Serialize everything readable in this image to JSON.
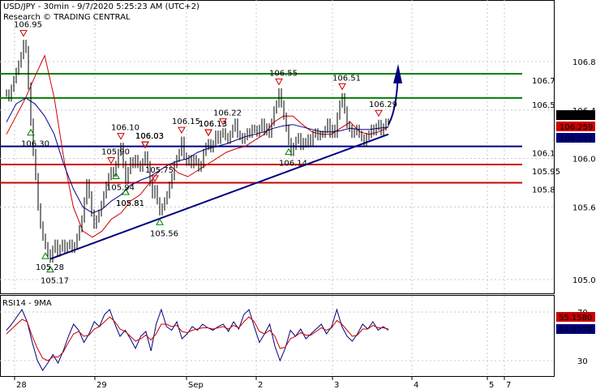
{
  "header": {
    "title": "USD/JPY - 30min - 9/7/2020 5:25:23 AM (UTC+2)",
    "credit": "Research © TRADING CENTRAL"
  },
  "rsi_label": "RSI14 - 9MA",
  "colors": {
    "price": "#000000",
    "ma_red": "#cc0000",
    "ma_blue": "#00008b",
    "support": "#000080",
    "resistance_green": "#008000",
    "level_red": "#cc0000",
    "arrow": "#000080"
  },
  "chart_data": [
    {
      "type": "line",
      "name": "price",
      "ylim": [
        104.85,
        107.05
      ],
      "yticks": [
        "106.8",
        "106.4",
        "106.0",
        "105.6",
        "105.0"
      ],
      "xticks": [
        "28",
        "29",
        "Sep",
        "2",
        "3",
        "4",
        "5",
        "7"
      ],
      "x": [
        0,
        3,
        6,
        9,
        12,
        15,
        18,
        21,
        24,
        27,
        30,
        33,
        36,
        39,
        42,
        45,
        48,
        51,
        54,
        57,
        60,
        63,
        66,
        69,
        72,
        75,
        78,
        81,
        84,
        87,
        90,
        93,
        96,
        99,
        102,
        105,
        108,
        111,
        114,
        117,
        120,
        123,
        126,
        129,
        132,
        135,
        138,
        141,
        144,
        147,
        150,
        153,
        156,
        159,
        162,
        165,
        168,
        171,
        174,
        177,
        180,
        183,
        186,
        189,
        192,
        195,
        198,
        201,
        204,
        207,
        210,
        213,
        216,
        219,
        222,
        225,
        228,
        231,
        234,
        237,
        240,
        243,
        246,
        249,
        252,
        255,
        258,
        261,
        264,
        267,
        270,
        273,
        276,
        279,
        282,
        285,
        288,
        291,
        294,
        297,
        300,
        303,
        306,
        309,
        312,
        315,
        318,
        321,
        324,
        327,
        330,
        333,
        336,
        339,
        342,
        345,
        348,
        351,
        354,
        357,
        360,
        363,
        366,
        369,
        372,
        375,
        378,
        381,
        384,
        387,
        390,
        393,
        396,
        399,
        402,
        405,
        408,
        411,
        414,
        417,
        420,
        423,
        426,
        429,
        432,
        435,
        438,
        441,
        444,
        447,
        450,
        453,
        456,
        459,
        462,
        465,
        468,
        471,
        474,
        477,
        480,
        483,
        486,
        489,
        492,
        495,
        498,
        501,
        504,
        507,
        510,
        513,
        516,
        519,
        522,
        525,
        528,
        531,
        534,
        537,
        540,
        543,
        546,
        549,
        552,
        555,
        558,
        561,
        564,
        567,
        570,
        573,
        576,
        579,
        582,
        585,
        588,
        591,
        594,
        597,
        600,
        603,
        606,
        609,
        612,
        615,
        618,
        621,
        624,
        627,
        630
      ],
      "series": [
        {
          "values": [
            106.54,
            106.5,
            106.58,
            106.65,
            106.72,
            106.78,
            106.85,
            106.95,
            106.9,
            106.6,
            106.3,
            106.05,
            105.85,
            105.6,
            105.45,
            105.35,
            105.28,
            105.22,
            105.17,
            105.25,
            105.3,
            105.22,
            105.26,
            105.3,
            105.25,
            105.28,
            105.3,
            105.25,
            105.28,
            105.35,
            105.42,
            105.5,
            105.65,
            105.8,
            105.7,
            105.55,
            105.45,
            105.5,
            105.55,
            105.62,
            105.7,
            105.78,
            105.85,
            105.9,
            105.88,
            105.95,
            106.05,
            106.1,
            105.95,
            105.82,
            105.9,
            105.98,
            105.95,
            106.0,
            105.95,
            105.92,
            105.97,
            106.03,
            105.95,
            105.8,
            105.7,
            105.75,
            105.65,
            105.56,
            105.6,
            105.65,
            105.7,
            105.78,
            105.85,
            105.95,
            106.0,
            106.05,
            106.15,
            106.02,
            105.97,
            106.0,
            105.95,
            106.0,
            105.97,
            105.92,
            105.95,
            106.05,
            106.1,
            106.13,
            106.08,
            106.12,
            106.2,
            106.15,
            106.2,
            106.22,
            106.18,
            106.15,
            106.2,
            106.25,
            106.3,
            106.2,
            106.18,
            106.15,
            106.18,
            106.22,
            106.2,
            106.25,
            106.24,
            106.21,
            106.25,
            106.3,
            106.22,
            106.26,
            106.2,
            106.3,
            106.4,
            106.45,
            106.55,
            106.45,
            106.35,
            106.25,
            106.14,
            106.05,
            106.1,
            106.15,
            106.18,
            106.1,
            106.14,
            106.12,
            106.17,
            106.13,
            106.2,
            106.22,
            106.18,
            106.2,
            106.2,
            106.24,
            106.3,
            106.2,
            106.25,
            106.2,
            106.35,
            106.45,
            106.51,
            106.4,
            106.28,
            106.25,
            106.2,
            106.22,
            106.25,
            106.2,
            106.17,
            106.13,
            106.18,
            106.2,
            106.25,
            106.22,
            106.26,
            106.29,
            106.22,
            106.26,
            106.3,
            106.295
          ]
        }
      ]
    },
    {
      "type": "line",
      "name": "moving_averages",
      "series": [
        {
          "color": "red",
          "values": [
            106.2,
            106.35,
            106.5,
            106.68,
            106.85,
            106.5,
            106.0,
            105.6,
            105.4,
            105.35,
            105.4,
            105.5,
            105.55,
            105.65,
            105.7,
            105.8,
            105.9,
            105.95,
            105.88,
            105.85,
            105.9,
            105.95,
            106.0,
            106.05,
            106.08,
            106.1,
            106.15,
            106.2,
            106.3,
            106.35,
            106.35,
            106.28,
            106.22,
            106.2,
            106.2,
            106.25,
            106.3,
            106.22,
            106.2,
            106.22,
            106.26
          ]
        },
        {
          "color": "blue",
          "values": [
            106.3,
            106.45,
            106.5,
            106.45,
            106.35,
            106.2,
            105.95,
            105.75,
            105.6,
            105.55,
            105.58,
            105.65,
            105.7,
            105.78,
            105.82,
            105.85,
            105.9,
            105.95,
            105.98,
            106.0,
            106.05,
            106.08,
            106.1,
            106.12,
            106.15,
            106.18,
            106.2,
            106.22,
            106.25,
            106.27,
            106.28,
            106.26,
            106.24,
            106.22,
            106.22,
            106.23,
            106.25,
            106.24,
            106.24,
            106.25,
            106.26
          ]
        }
      ]
    },
    {
      "type": "table",
      "name": "annotations",
      "price_labels": [
        "106.95",
        "105.17",
        "105.28",
        "105.81",
        "106.10",
        "105.75",
        "106.03",
        "105.56",
        "106.15",
        "105.81",
        "106.13",
        "105.90",
        "106.30",
        "106.03",
        "106.55",
        "106.14",
        "105.94",
        "106.22",
        "106.03",
        "106.51",
        "106.13",
        "106.29"
      ],
      "horizontal_levels": [
        "106.7",
        "106.5",
        "106.1",
        "105.95",
        "105.8"
      ],
      "price_badges": [
        "106.295",
        "106.259",
        "106.251"
      ]
    },
    {
      "type": "line",
      "name": "rsi",
      "yticks": [
        "70",
        "30"
      ],
      "badges": [
        "55.1580",
        "54.8278"
      ],
      "series": [
        {
          "name": "RSI",
          "values": [
            55,
            60,
            66,
            72,
            62,
            45,
            30,
            22,
            28,
            35,
            28,
            38,
            50,
            60,
            55,
            45,
            52,
            62,
            58,
            68,
            72,
            60,
            50,
            55,
            48,
            40,
            50,
            54,
            38,
            60,
            72,
            58,
            55,
            62,
            48,
            52,
            58,
            55,
            60,
            57,
            55,
            58,
            60,
            54,
            62,
            56,
            68,
            72,
            58,
            45,
            52,
            60,
            42,
            30,
            40,
            55,
            50,
            56,
            48,
            52,
            56,
            60,
            52,
            58,
            72,
            58,
            50,
            46,
            52,
            60,
            56,
            62,
            55,
            58,
            55
          ]
        },
        {
          "name": "MA",
          "color": "red",
          "values": [
            52,
            56,
            60,
            64,
            62,
            50,
            40,
            32,
            30,
            33,
            33,
            37,
            45,
            52,
            54,
            50,
            51,
            56,
            58,
            62,
            66,
            62,
            56,
            54,
            50,
            46,
            48,
            51,
            47,
            52,
            60,
            60,
            58,
            59,
            54,
            53,
            55,
            56,
            57,
            57,
            56,
            57,
            58,
            56,
            59,
            57,
            62,
            66,
            62,
            54,
            52,
            55,
            50,
            40,
            41,
            48,
            50,
            53,
            51,
            51,
            54,
            57,
            55,
            57,
            63,
            60,
            55,
            50,
            51,
            56,
            56,
            59,
            57,
            57,
            56
          ]
        }
      ]
    }
  ]
}
